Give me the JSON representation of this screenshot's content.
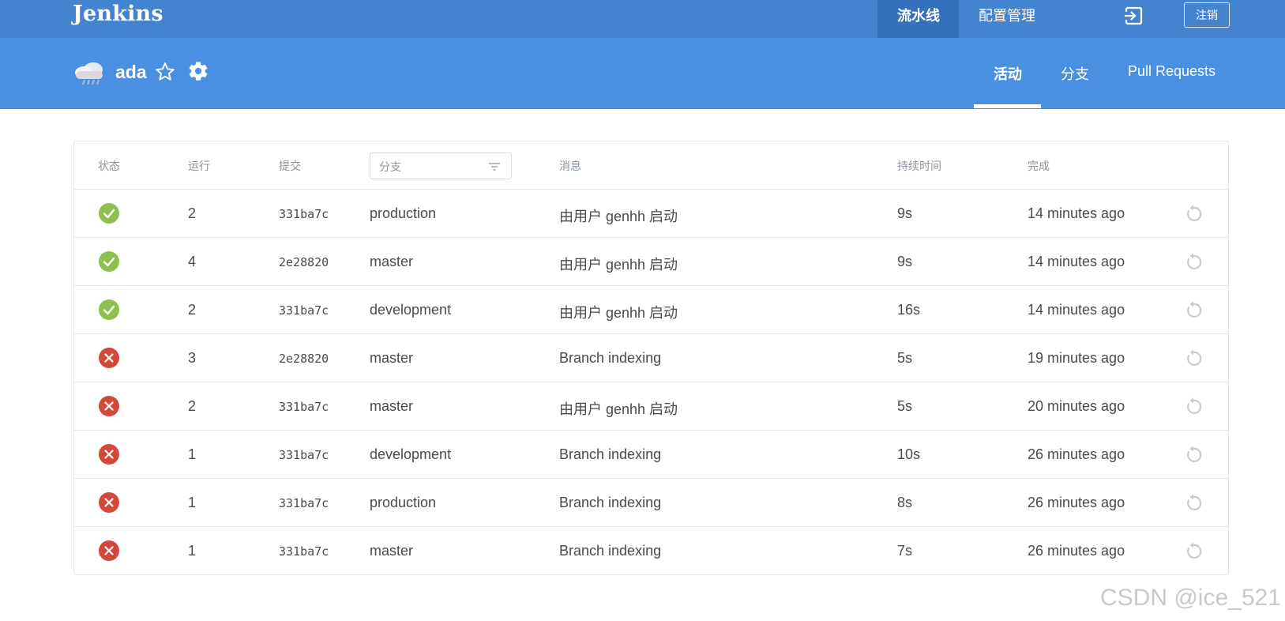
{
  "topbar": {
    "logo": "Jenkins",
    "nav": [
      {
        "label": "流水线",
        "active": true
      },
      {
        "label": "配置管理",
        "active": false
      }
    ],
    "logout_label": "注销",
    "bar_color": "#4383d0"
  },
  "header": {
    "job_name": "ada",
    "tabs": [
      {
        "label": "活动",
        "active": true
      },
      {
        "label": "分支",
        "active": false
      },
      {
        "label": "Pull Requests",
        "active": false
      }
    ],
    "header_color": "#4a90e2"
  },
  "table": {
    "columns": {
      "status": "状态",
      "run": "运行",
      "commit": "提交",
      "branch_filter": "分支",
      "message": "消息",
      "duration": "持续时间",
      "completed": "完成"
    },
    "rows": [
      {
        "status": "success",
        "run": "2",
        "commit": "331ba7c",
        "branch": "production",
        "message": "由用户 genhh 启动",
        "duration": "9s",
        "completed": "14 minutes ago"
      },
      {
        "status": "success",
        "run": "4",
        "commit": "2e28820",
        "branch": "master",
        "message": "由用户 genhh 启动",
        "duration": "9s",
        "completed": "14 minutes ago"
      },
      {
        "status": "success",
        "run": "2",
        "commit": "331ba7c",
        "branch": "development",
        "message": "由用户 genhh 启动",
        "duration": "16s",
        "completed": "14 minutes ago"
      },
      {
        "status": "failure",
        "run": "3",
        "commit": "2e28820",
        "branch": "master",
        "message": "Branch indexing",
        "duration": "5s",
        "completed": "19 minutes ago"
      },
      {
        "status": "failure",
        "run": "2",
        "commit": "331ba7c",
        "branch": "master",
        "message": "由用户 genhh 启动",
        "duration": "5s",
        "completed": "20 minutes ago"
      },
      {
        "status": "failure",
        "run": "1",
        "commit": "331ba7c",
        "branch": "development",
        "message": "Branch indexing",
        "duration": "10s",
        "completed": "26 minutes ago"
      },
      {
        "status": "failure",
        "run": "1",
        "commit": "331ba7c",
        "branch": "production",
        "message": "Branch indexing",
        "duration": "8s",
        "completed": "26 minutes ago"
      },
      {
        "status": "failure",
        "run": "1",
        "commit": "331ba7c",
        "branch": "master",
        "message": "Branch indexing",
        "duration": "7s",
        "completed": "26 minutes ago"
      }
    ],
    "status_colors": {
      "success": "#8cc04f",
      "failure": "#d24939"
    }
  },
  "icons": {
    "exit": "exit-icon",
    "weather": "cloud-rain-icon",
    "favorite": "star-icon",
    "configure": "gear-icon",
    "filter": "filter-icon",
    "replay": "replay-icon"
  },
  "watermark": "CSDN @ice_521"
}
